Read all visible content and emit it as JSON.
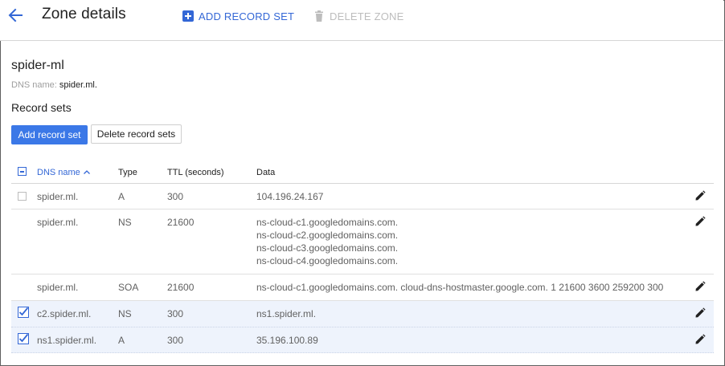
{
  "header": {
    "title": "Zone details",
    "add_record_set": "ADD RECORD SET",
    "delete_zone": "DELETE ZONE"
  },
  "zone": {
    "name": "spider-ml",
    "dns_label": "DNS name:",
    "dns_value": "spider.ml."
  },
  "records": {
    "section_title": "Record sets",
    "add_button": "Add record set",
    "delete_button": "Delete record sets",
    "columns": {
      "name": "DNS name",
      "type": "Type",
      "ttl": "TTL (seconds)",
      "data": "Data"
    },
    "rows": [
      {
        "name": "spider.ml.",
        "type": "A",
        "ttl": "300",
        "data": [
          "104.196.24.167"
        ],
        "checkbox": "unchecked"
      },
      {
        "name": "spider.ml.",
        "type": "NS",
        "ttl": "21600",
        "data": [
          "ns-cloud-c1.googledomains.com.",
          "ns-cloud-c2.googledomains.com.",
          "ns-cloud-c3.googledomains.com.",
          "ns-cloud-c4.googledomains.com."
        ],
        "checkbox": "none"
      },
      {
        "name": "spider.ml.",
        "type": "SOA",
        "ttl": "21600",
        "data": [
          "ns-cloud-c1.googledomains.com. cloud-dns-hostmaster.google.com. 1 21600 3600 259200 300"
        ],
        "checkbox": "none"
      },
      {
        "name": "c2.spider.ml.",
        "type": "NS",
        "ttl": "300",
        "data": [
          "ns1.spider.ml."
        ],
        "checkbox": "checked"
      },
      {
        "name": "ns1.spider.ml.",
        "type": "A",
        "ttl": "300",
        "data": [
          "35.196.100.89"
        ],
        "checkbox": "checked"
      }
    ]
  },
  "icons": {
    "back": "arrow-back-icon",
    "add": "add-box-icon",
    "delete": "trash-icon",
    "sort": "arrow-up-icon",
    "edit": "pencil-icon"
  },
  "colors": {
    "accent": "#3367d6",
    "primary_button": "#3b78e7",
    "disabled": "#bdbdbd",
    "selected_row": "#eef3fc"
  }
}
